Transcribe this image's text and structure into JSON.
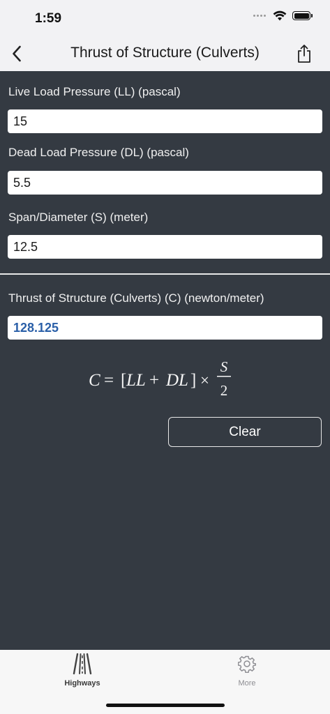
{
  "status_bar": {
    "time": "1:59"
  },
  "nav": {
    "title": "Thrust of Structure (Culverts)"
  },
  "inputs": [
    {
      "label": "Live Load Pressure (LL) (pascal)",
      "value": "15"
    },
    {
      "label": "Dead Load Pressure (DL) (pascal)",
      "value": "5.5"
    },
    {
      "label": "Span/Diameter (S) (meter)",
      "value": "12.5"
    }
  ],
  "result": {
    "label": "Thrust of Structure (Culverts) (C) (newton/meter)",
    "value": "128.125"
  },
  "formula": {
    "lhs": "C",
    "equals": "=",
    "bracket_open": "[",
    "term1": "LL",
    "plus": "+",
    "term2": "DL",
    "bracket_close": "]",
    "times": "×",
    "numerator": "S",
    "denominator": "2"
  },
  "actions": {
    "clear_label": "Clear"
  },
  "tabs": [
    {
      "label": "Highways",
      "icon": "highway-icon",
      "selected": true
    },
    {
      "label": "More",
      "icon": "gear-icon",
      "selected": false
    }
  ],
  "colors": {
    "background": "#343a42",
    "result_text": "#2a5fa8",
    "bar_background": "#f2f2f4"
  }
}
